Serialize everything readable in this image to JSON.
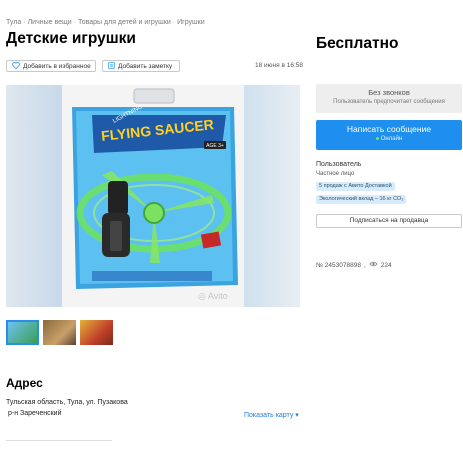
{
  "breadcrumb": [
    "Тула",
    "Личные вещи",
    "Товары для детей и игрушки",
    "Игрушки"
  ],
  "breadcrumb_separator": "·",
  "listing": {
    "title": "Детские игрушки",
    "price": "Бесплатно",
    "date": "18 июня в 16:58",
    "add_favorite_label": "Добавить в избранное",
    "add_note_label": "Добавить заметку",
    "watermark": "Avito",
    "product_packaging_text": {
      "brand": "FLYING SAUCER",
      "top_band": "LIGHTNING",
      "age": "AGE 3+"
    }
  },
  "thumbnails_count": 3,
  "address": {
    "title": "Адрес",
    "line": "Тульская область, Тула, ул. Пузакова",
    "district": "р-н Зареченский",
    "show_map_label": "Показать карту"
  },
  "contact": {
    "no_calls_title": "Без звонков",
    "no_calls_sub": "Пользователь предпочитает сообщения",
    "message_label": "Написать сообщение",
    "online_label": "Онлайн"
  },
  "seller": {
    "role": "Пользователь",
    "type": "Частное лицо",
    "badges": [
      "5 продаж с Авито Доставкой",
      "Экологический вклад – 16 кг CO₂"
    ],
    "subscribe_label": "Подписаться на продавца"
  },
  "ad_meta": {
    "number": "№ 2453078898",
    "views": "224"
  },
  "colors": {
    "accent": "#1e8fee",
    "badge_bg": "#d6ecfb",
    "link": "#1e7be0"
  }
}
